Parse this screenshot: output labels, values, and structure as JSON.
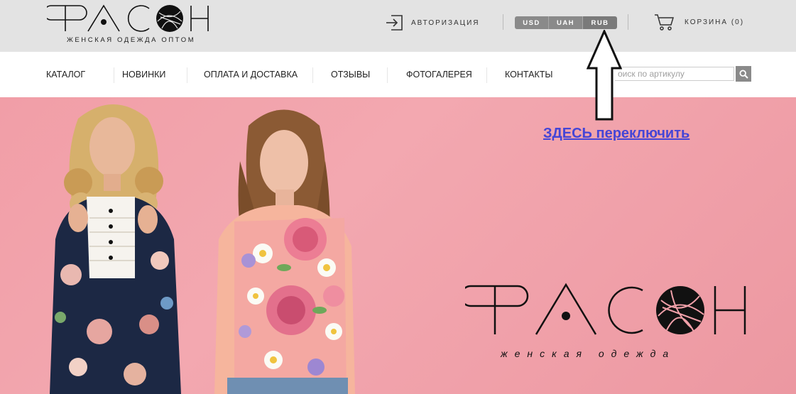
{
  "header": {
    "logo_text": "ФАСОН",
    "logo_tagline": "ЖЕНСКАЯ ОДЕЖДА ОПТОМ",
    "auth_label": "АВТОРИЗАЦИЯ",
    "currencies": [
      "USD",
      "UAH",
      "RUB"
    ],
    "active_currency": "RUB",
    "cart_label": "КОРЗИНА (0)"
  },
  "nav": {
    "items": [
      "КАТАЛОГ",
      "НОВИНКИ",
      "ОПЛАТА И ДОСТАВКА",
      "ОТЗЫВЫ",
      "ФОТОГАЛЕРЕЯ",
      "КОНТАКТЫ"
    ],
    "search_placeholder": "оиск по артикулу"
  },
  "hero": {
    "brand_text": "ФАСОН",
    "brand_tagline": "женская одежда"
  },
  "annotation": {
    "text": "ЗДЕСЬ переключить"
  },
  "colors": {
    "topbar_bg": "#e3e3e3",
    "hero_bg": "#f3a8b0",
    "currency_bg": "#8a8a8a",
    "annotation_link": "#4545d6"
  },
  "icons": [
    "login-icon",
    "cart-icon",
    "search-icon",
    "up-arrow-icon"
  ]
}
